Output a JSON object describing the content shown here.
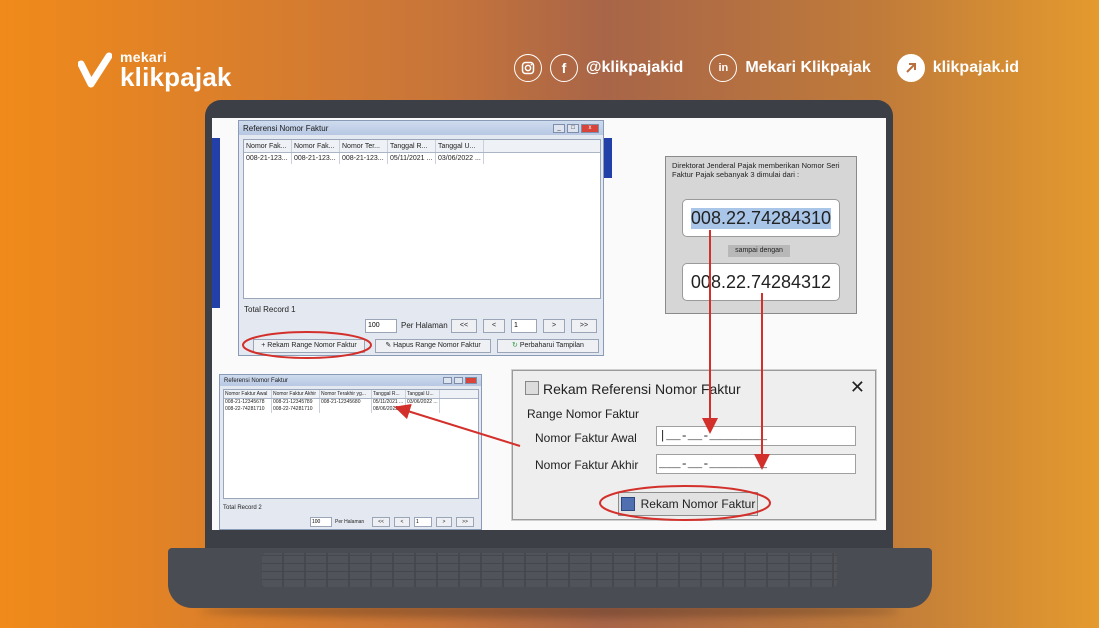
{
  "header": {
    "brand_small": "mekari",
    "brand_big": "klikpajak",
    "instagram_handle": "@klikpajakid",
    "linkedin_label": "Mekari Klikpajak",
    "website": "klikpajak.id"
  },
  "icons": {
    "instagram": "instagram-icon",
    "facebook": "facebook-icon",
    "linkedin": "linkedin-icon",
    "link": "external-link-icon"
  },
  "colors": {
    "accent_orange": "#f08a1a",
    "annotation_red": "#d3302b"
  },
  "win_large": {
    "title": "Referensi Nomor Faktur",
    "columns": [
      "Nomor Fak...",
      "Nomor Fak...",
      "Nomor Ter...",
      "Tanggal R...",
      "Tanggal U..."
    ],
    "rows": [
      [
        "008-21-123...",
        "008-21-123...",
        "008-21-123...",
        "05/11/2021 ...",
        "03/06/2022 ..."
      ]
    ],
    "total_record": "Total Record  1",
    "per_page_value": "100",
    "per_page_label": "Per Halaman",
    "nav_first": "<<",
    "nav_prev": "<",
    "page_value": "1",
    "nav_next": ">",
    "nav_last": ">>",
    "btn_rekam": "Rekam Range Nomor Faktur",
    "btn_hapus": "Hapus Range Nomor Faktur",
    "btn_perbaharui": "Perbaharui Tampilan"
  },
  "win_small": {
    "title": "Referensi Nomor Faktur",
    "columns": [
      "Nomor Faktur Awal",
      "Nomor Faktur Akhir",
      "Nomor Terakhir yg...",
      "Tanggal R...",
      "Tanggal U..."
    ],
    "rows": [
      [
        "008-21-12345678",
        "008-21-12345789",
        "008-21-12345680",
        "05/11/2021 ...",
        "03/06/2022 ..."
      ],
      [
        "008-22-74281710",
        "008-22-74281710",
        "",
        "08/06/2022 ...",
        ""
      ]
    ],
    "total_record": "Total Record  2",
    "per_page_value": "100",
    "per_page_label": "Per Halaman",
    "nav_first": "<<",
    "nav_prev": "<",
    "page_value": "1",
    "nav_next": ">",
    "nav_last": ">>"
  },
  "dialog": {
    "title": "Rekam Referensi Nomor Faktur",
    "section": "Range Nomor Faktur",
    "awal_label": "Nomor Faktur Awal",
    "akhir_label": "Nomor Faktur Akhir",
    "awal_value": "|__-__-________",
    "akhir_value": "___-__-________",
    "button": "Rekam Nomor Faktur"
  },
  "info_box": {
    "text": "Direktorat Jenderal Pajak memberikan Nomor Seri Faktur Pajak sebanyak 3 dimulai dari :",
    "start_number": "008.22.74284310",
    "between": "sampai dengan",
    "end_number": "008.22.74284312"
  }
}
